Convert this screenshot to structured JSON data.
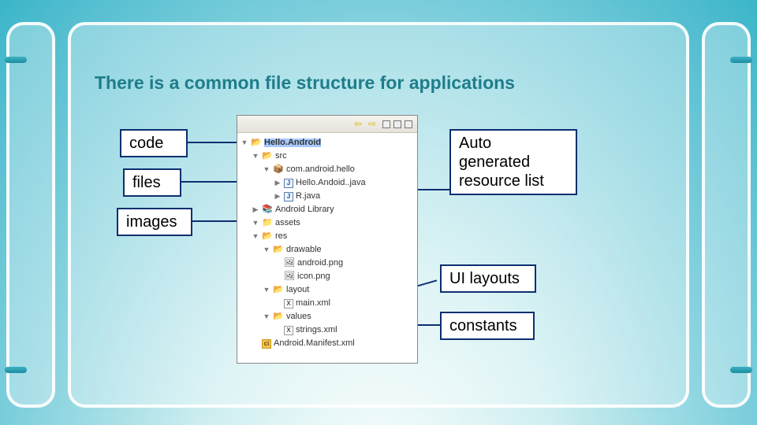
{
  "title": "There is a common file structure for applications",
  "labels": {
    "code": "code",
    "files": "files",
    "images": "images",
    "auto": "Auto\ngenerated\nresource list",
    "ui": "UI layouts",
    "constants": "constants"
  },
  "tree": {
    "project": "Hello.Android",
    "src": "src",
    "package": "com.android.hello",
    "helloJava": "Hello.Andoid..java",
    "rJava": "R.java",
    "androidLib": "Android Library",
    "assets": "assets",
    "res": "res",
    "drawable": "drawable",
    "androidPng": "android.png",
    "iconPng": "icon.png",
    "layout": "layout",
    "mainXml": "main.xml",
    "values": "values",
    "stringsXml": "strings.xml",
    "manifest": "Android.Manifest.xml"
  }
}
